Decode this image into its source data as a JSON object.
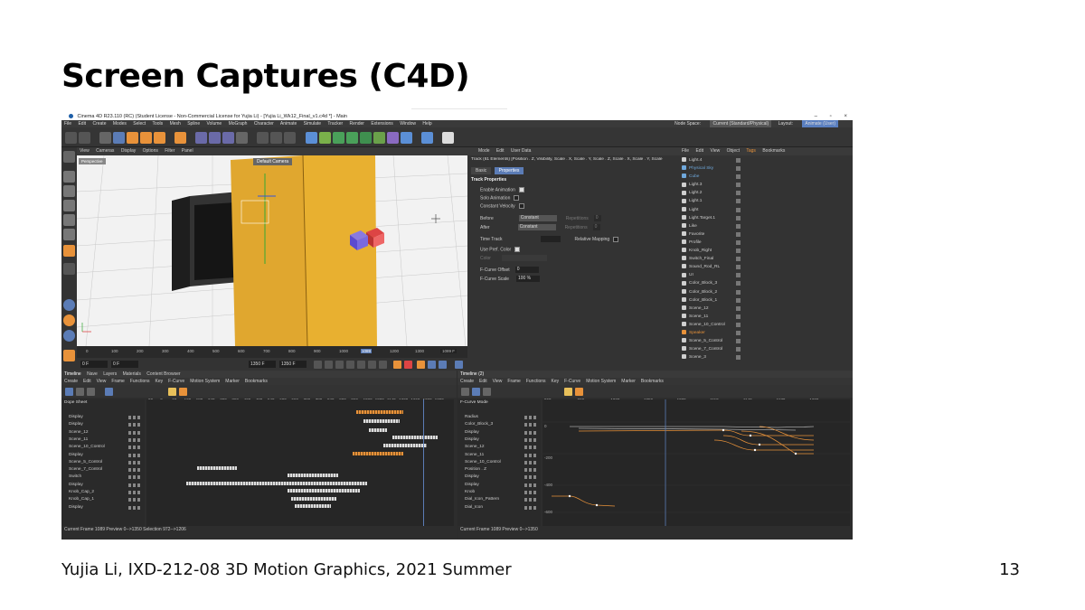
{
  "slide": {
    "title": "Screen Captures (C4D)",
    "footer": "Yujia Li, IXD-212-08 3D Motion Graphics, 2021 Summer",
    "page_number": "13"
  },
  "app": {
    "window_title": "Cinema 4D R23.110 (RC) (Student License - Non-Commercial License for Yujia Li) - [Yujia Li_Wk12_Final_v1.c4d *] - Main",
    "window_controls": [
      "–",
      "▫",
      "×"
    ],
    "menu": [
      "File",
      "Edit",
      "Create",
      "Modes",
      "Select",
      "Tools",
      "Mesh",
      "Spline",
      "Volume",
      "MoGraph",
      "Character",
      "Animate",
      "Simulate",
      "Tracker",
      "Render",
      "Extensions",
      "Window",
      "Help"
    ],
    "node_space_label": "Node Space:",
    "node_space_value": "Current (Standard/Physical)",
    "layout_label": "Layout:",
    "layout_value": "Animate (User)"
  },
  "viewport": {
    "menu": [
      "View",
      "Cameras",
      "Display",
      "Options",
      "Filter",
      "Panel"
    ],
    "camera_label": "Default Camera",
    "perspective_label": "Perspective",
    "ruler_ticks": [
      "0",
      "100",
      "200",
      "300",
      "400",
      "500",
      "600",
      "700",
      "800",
      "900",
      "1000",
      "1089",
      "1200",
      "1300"
    ],
    "frame_field": "0 F",
    "frame_field2": "0 F",
    "end_field": "1350 F",
    "end_field2": "1350 F",
    "current_frame_badge": "1089 F"
  },
  "attributes": {
    "menu": [
      "Mode",
      "Edit",
      "User Data"
    ],
    "track_title": "Track (61 Elements) [Position . Z, Visibility, Scale . X, Scale . Y, Scale . Z, Scale . X, Scale . Y, Scale",
    "tabs": [
      "Basic",
      "Properties"
    ],
    "section": "Track Properties",
    "enable_animation": "Enable Animation",
    "solo_animation": "Solo Animation",
    "constant_velocity": "Constant Velocity",
    "before_label": "Before",
    "before_value": "Constant",
    "after_label": "After",
    "after_value": "Constant",
    "repetitions_label": "Repetitions",
    "repetitions_value": "0",
    "time_track": "Time Track",
    "relative_mapping": "Relative Mapping",
    "use_pref_color": "Use Pref. Color",
    "color_label": "Color",
    "fcurve_offset_label": "F-Curve Offset",
    "fcurve_offset_value": "0",
    "fcurve_scale_label": "F-Curve Scale",
    "fcurve_scale_value": "100 %"
  },
  "objects": {
    "menu": [
      "File",
      "Edit",
      "View",
      "Object",
      "Tags",
      "Bookmarks"
    ],
    "items": [
      {
        "name": "Light.4",
        "color": "#cfcfcf"
      },
      {
        "name": "Physical Sky",
        "color": "#6fa8dc"
      },
      {
        "name": "Cube",
        "color": "#6fa8dc"
      },
      {
        "name": "Light.3",
        "color": "#cfcfcf"
      },
      {
        "name": "Light.2",
        "color": "#cfcfcf"
      },
      {
        "name": "Light.1",
        "color": "#cfcfcf"
      },
      {
        "name": "Light",
        "color": "#cfcfcf"
      },
      {
        "name": "Light.Target.1",
        "color": "#cfcfcf"
      },
      {
        "name": "Like",
        "color": "#cfcfcf"
      },
      {
        "name": "Favorite",
        "color": "#cfcfcf"
      },
      {
        "name": "Profile",
        "color": "#cfcfcf"
      },
      {
        "name": "Knob_Right",
        "color": "#cfcfcf"
      },
      {
        "name": "Switch_Final",
        "color": "#cfcfcf"
      },
      {
        "name": "Sound_Rod_RL",
        "color": "#cfcfcf"
      },
      {
        "name": "UI",
        "color": "#cfcfcf"
      },
      {
        "name": "Color_Block_3",
        "color": "#cfcfcf"
      },
      {
        "name": "Color_Block_2",
        "color": "#cfcfcf"
      },
      {
        "name": "Color_Block_1",
        "color": "#cfcfcf"
      },
      {
        "name": "Scene_12",
        "color": "#cfcfcf"
      },
      {
        "name": "Scene_11",
        "color": "#cfcfcf"
      },
      {
        "name": "Scene_10_Control",
        "color": "#cfcfcf"
      },
      {
        "name": "Speaker",
        "color": "#e8923a"
      },
      {
        "name": "Scene_5_Control",
        "color": "#cfcfcf"
      },
      {
        "name": "Scene_7_Control",
        "color": "#cfcfcf"
      },
      {
        "name": "Scene_3",
        "color": "#cfcfcf"
      }
    ]
  },
  "timeline_left": {
    "header": [
      "Timeline",
      "Nave",
      "Layers",
      "Materials",
      "Content Browser"
    ],
    "menu": [
      "Create",
      "Edit",
      "View",
      "Frame",
      "Functions",
      "Key",
      "F-Curve",
      "Motion System",
      "Marker",
      "Bookmarks"
    ],
    "mode_label": "Dope Sheet",
    "scale": [
      "60",
      "0",
      "60",
      "120",
      "180",
      "240",
      "300",
      "360",
      "420",
      "480",
      "540",
      "600",
      "660",
      "720",
      "780",
      "840",
      "900",
      "960",
      "1020",
      "1080",
      "1140",
      "1200",
      "1260",
      "1320",
      "1380"
    ],
    "rows": [
      "Display",
      "Display",
      "Scene_12",
      "Scene_11",
      "Scene_10_Control",
      "Display",
      "Scene_5_Control",
      "Scene_7_Control",
      "Switch",
      "Display",
      "Knob_Cap_2",
      "Knob_Cap_1",
      "Display"
    ],
    "status": "Current Frame  1089  Preview  0-->1350    Selection  972-->1206"
  },
  "timeline_right": {
    "header": [
      "Timeline (2)"
    ],
    "menu": [
      "Create",
      "Edit",
      "View",
      "Frame",
      "Functions",
      "Key",
      "F-Curve",
      "Motion System",
      "Marker",
      "Bookmarks"
    ],
    "mode_label": "F-Curve Mode",
    "scale": [
      "960",
      "990",
      "1020",
      "1050",
      "1089",
      "1110",
      "1140",
      "1170",
      "1200"
    ],
    "rows": [
      "Radius",
      "Color_Block_3",
      "Display",
      "Display",
      "Scene_12",
      "Scene_11",
      "Scene_10_Control",
      "Position . Z",
      "Display",
      "Display",
      "Knob",
      "Dial_Icon_Pattern",
      "Dial_Icon"
    ],
    "y_axis": [
      "0",
      "-200",
      "-400",
      "-600"
    ],
    "status": "Current Frame  1089  Preview  0-->1350"
  }
}
